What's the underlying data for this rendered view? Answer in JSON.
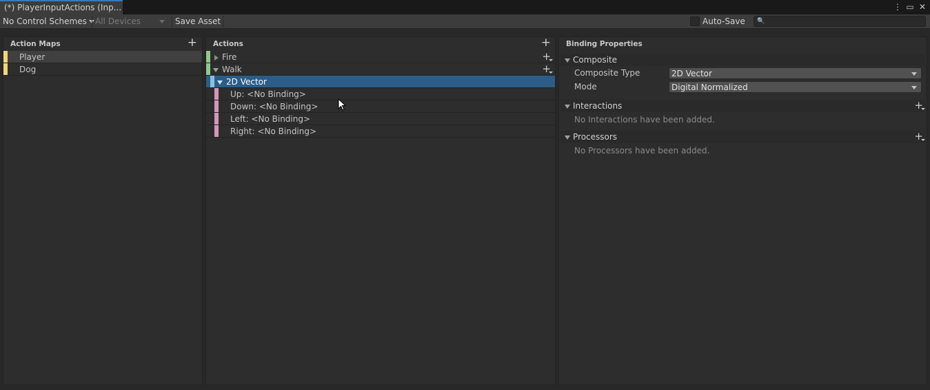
{
  "window": {
    "tab_title": "(*) PlayerInputActions (Inp...",
    "icons": [
      "kebab-menu-icon",
      "maximize-icon",
      "close-icon"
    ]
  },
  "toolbar": {
    "control_schemes": "No Control Schemes",
    "devices": "All Devices",
    "save_asset": "Save Asset",
    "auto_save_label": "Auto-Save",
    "auto_save_checked": false,
    "search_value": ""
  },
  "action_maps": {
    "header": "Action Maps",
    "items": [
      {
        "label": "Player",
        "color": "#f2d57a",
        "selected": true
      },
      {
        "label": "Dog",
        "color": "#f2d57a",
        "selected": false
      }
    ]
  },
  "actions": {
    "header": "Actions",
    "items": [
      {
        "label": "Fire",
        "color": "#8fc98a",
        "expanded": false
      },
      {
        "label": "Walk",
        "color": "#8fc98a",
        "expanded": true
      }
    ],
    "composite": {
      "label": "2D Vector",
      "color": "#8bc0d8",
      "selected": true
    },
    "bindings": [
      {
        "label": "Up: <No Binding>",
        "color": "#d796b7"
      },
      {
        "label": "Down: <No Binding>",
        "color": "#d796b7"
      },
      {
        "label": "Left: <No Binding>",
        "color": "#d796b7"
      },
      {
        "label": "Right: <No Binding>",
        "color": "#d796b7"
      }
    ]
  },
  "binding_properties": {
    "header": "Binding Properties",
    "composite": {
      "title": "Composite",
      "type_label": "Composite Type",
      "type_value": "2D Vector",
      "mode_label": "Mode",
      "mode_value": "Digital Normalized"
    },
    "interactions": {
      "title": "Interactions",
      "empty": "No Interactions have been added."
    },
    "processors": {
      "title": "Processors",
      "empty": "No Processors have been added."
    }
  }
}
